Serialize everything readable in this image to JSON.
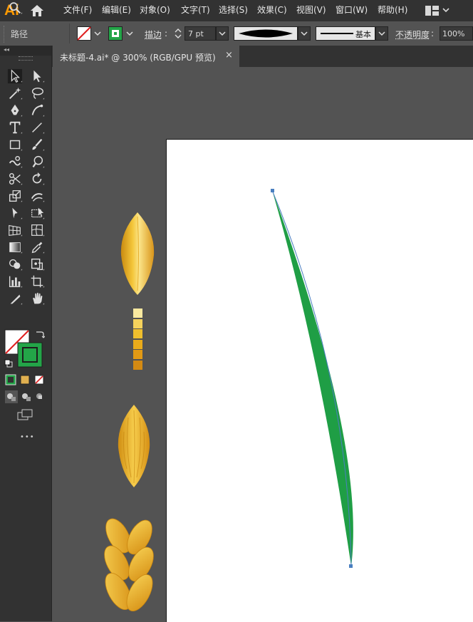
{
  "app": {
    "logo": "Ai"
  },
  "menu": [
    {
      "label": "文件(F)",
      "name": "menu-file"
    },
    {
      "label": "编辑(E)",
      "name": "menu-edit"
    },
    {
      "label": "对象(O)",
      "name": "menu-object"
    },
    {
      "label": "文字(T)",
      "name": "menu-type"
    },
    {
      "label": "选择(S)",
      "name": "menu-select"
    },
    {
      "label": "效果(C)",
      "name": "menu-effect"
    },
    {
      "label": "视图(V)",
      "name": "menu-view"
    },
    {
      "label": "窗口(W)",
      "name": "menu-window"
    },
    {
      "label": "帮助(H)",
      "name": "menu-help"
    }
  ],
  "control": {
    "selection_label": "路径",
    "stroke_label": "描边",
    "stroke_value": "7 pt",
    "profile_label": "基本",
    "opacity_label": "不透明度",
    "opacity_value": "100%"
  },
  "tab": {
    "title": "未标题-4.ai* @ 300% (RGB/GPU 预览)",
    "close": "×"
  },
  "toolbar": {
    "more": "•••"
  },
  "colors": {
    "fill": "none",
    "stroke": "#23a548",
    "leaf": "#1f9e45",
    "swatches": [
      "#f9e9a0",
      "#f5d25c",
      "#f0bf2d",
      "#eaab1a",
      "#e29a14",
      "#d48a12"
    ]
  },
  "icons": [
    "home-icon",
    "workspace-switcher-icon",
    "selection-tool-icon",
    "direct-selection-tool-icon",
    "magic-wand-icon",
    "lasso-icon",
    "pen-icon",
    "curvature-icon",
    "type-icon",
    "line-icon",
    "rectangle-icon",
    "paintbrush-icon",
    "shaper-icon",
    "blob-brush-icon",
    "scissors-icon",
    "rotate-icon",
    "scale-icon",
    "warp-icon",
    "puppet-warp-icon",
    "free-transform-icon",
    "perspective-grid-icon",
    "mesh-icon",
    "gradient-icon",
    "eyedropper-icon",
    "shape-builder-icon",
    "live-paint-icon",
    "graph-icon",
    "artboard-icon",
    "slice-icon",
    "hand-icon",
    "zoom-icon"
  ]
}
